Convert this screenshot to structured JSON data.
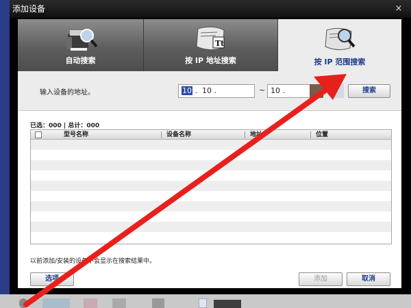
{
  "window": {
    "title": "添加设备",
    "close_icon": "×"
  },
  "tabs": [
    {
      "label": "自动搜索",
      "icon": "printer-search-icon",
      "active": false
    },
    {
      "label": "按 IP 地址搜索",
      "icon": "scroll-text-icon",
      "active": false
    },
    {
      "label": "按 IP 范围搜索",
      "icon": "scroll-search-icon",
      "active": true
    }
  ],
  "range": {
    "label": "输入设备的地址。",
    "from": {
      "oct1": "10",
      "sep1": ".",
      "oct2": "10",
      "sep2": "."
    },
    "tilde": "~",
    "to": {
      "oct1": "10",
      "sep1": "."
    }
  },
  "buttons": {
    "search": "搜索",
    "options": "选项",
    "add": "添加",
    "cancel": "取消"
  },
  "summary": "已选：000 | 总计：000",
  "table": {
    "columns": [
      "型号名称",
      "设备名称",
      "地址",
      "位置"
    ],
    "rows": []
  },
  "note": "以前添加/安装的设备不会显示在搜索结果中。",
  "colors": {
    "active_tab_text": "#1f3d8a",
    "arrow": "#e8201c"
  }
}
